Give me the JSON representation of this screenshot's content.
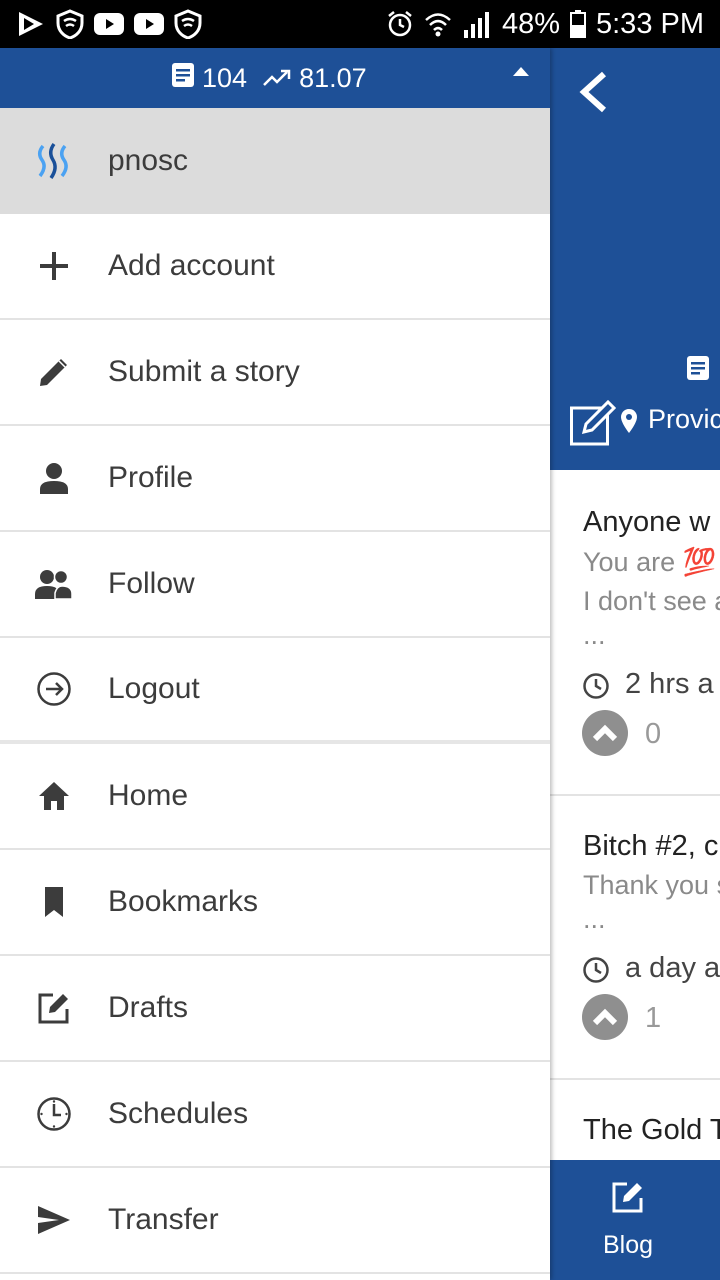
{
  "status_bar": {
    "battery": "48%",
    "time": "5:33 PM"
  },
  "drawer": {
    "stats": {
      "posts": "104",
      "reputation": "81.07"
    },
    "account": {
      "username": "pnosc"
    },
    "account_items": [
      {
        "label": "Add account",
        "icon": "plus-icon"
      },
      {
        "label": "Submit a story",
        "icon": "pencil-icon"
      },
      {
        "label": "Profile",
        "icon": "person-icon"
      },
      {
        "label": "Follow",
        "icon": "people-icon"
      },
      {
        "label": "Logout",
        "icon": "logout-icon"
      }
    ],
    "nav_items": [
      {
        "label": "Home",
        "icon": "home-icon"
      },
      {
        "label": "Bookmarks",
        "icon": "bookmark-icon"
      },
      {
        "label": "Drafts",
        "icon": "edit-box-icon"
      },
      {
        "label": "Schedules",
        "icon": "clock-icon"
      },
      {
        "label": "Transfer",
        "icon": "send-icon"
      }
    ]
  },
  "background": {
    "location": "Provic",
    "feed": [
      {
        "title": "Anyone w",
        "line1": "You are 💯 ",
        "line2": "I don't see a",
        "line3": "...",
        "time": "2 hrs a",
        "votes": "0"
      },
      {
        "title": "Bitch #2, c",
        "line1": "Thank you s",
        "line2": "...",
        "time": "a day a",
        "votes": "1"
      },
      {
        "title": "The Gold T"
      }
    ],
    "bottom_tab": {
      "label": "Blog"
    }
  },
  "colors": {
    "primary": "#1e5097",
    "account_bg": "#dcdcdc",
    "divider": "#e3e3e3"
  }
}
